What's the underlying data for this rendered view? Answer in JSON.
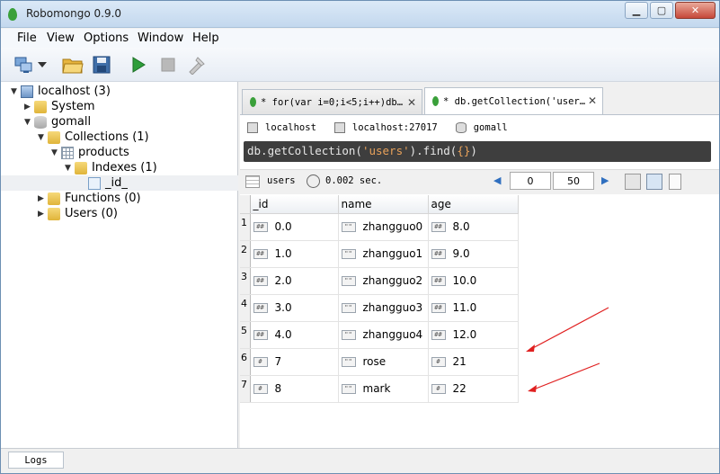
{
  "window": {
    "title": "Robomongo 0.9.0",
    "min_label": "▁",
    "max_label": "▢",
    "close_label": "✕"
  },
  "menu": [
    "File",
    "View",
    "Options",
    "Window",
    "Help"
  ],
  "toolbar": {
    "icons": [
      "connect-icon",
      "dropdown-icon",
      "open-icon",
      "save-icon",
      "run-icon",
      "stop-icon",
      "tools-icon"
    ]
  },
  "tree": {
    "server": "localhost (3)",
    "system": "System",
    "db": "gomall",
    "collections": "Collections (1)",
    "collection": "products",
    "indexes": "Indexes (1)",
    "index": "_id_",
    "functions": "Functions (0)",
    "users": "Users (0)"
  },
  "tabs": [
    {
      "label": "* for(var i=0;i<5;i++)db…",
      "close": "✕"
    },
    {
      "label": "* db.getCollection('user…",
      "close": "✕"
    }
  ],
  "breadcrumb": {
    "server": "localhost",
    "host": "localhost:27017",
    "db": "gomall"
  },
  "query": {
    "prefix": "db.getCollection(",
    "arg": "'users'",
    "suffix": ").find(",
    "braces": "{}",
    "close": ")"
  },
  "results_bar": {
    "collection": "users",
    "time": "0.002 sec.",
    "skip": "0",
    "limit": "50",
    "prev": "◀",
    "next": "▶"
  },
  "grid": {
    "columns": [
      "_id",
      "name",
      "age"
    ],
    "rows": [
      {
        "n": "1",
        "id": "0.0",
        "name": "zhangguo0",
        "age": "8.0",
        "id_type": "##",
        "name_type": "\"\"",
        "age_type": "##"
      },
      {
        "n": "2",
        "id": "1.0",
        "name": "zhangguo1",
        "age": "9.0",
        "id_type": "##",
        "name_type": "\"\"",
        "age_type": "##"
      },
      {
        "n": "3",
        "id": "2.0",
        "name": "zhangguo2",
        "age": "10.0",
        "id_type": "##",
        "name_type": "\"\"",
        "age_type": "##"
      },
      {
        "n": "4",
        "id": "3.0",
        "name": "zhangguo3",
        "age": "11.0",
        "id_type": "##",
        "name_type": "\"\"",
        "age_type": "##"
      },
      {
        "n": "5",
        "id": "4.0",
        "name": "zhangguo4",
        "age": "12.0",
        "id_type": "##",
        "name_type": "\"\"",
        "age_type": "##"
      },
      {
        "n": "6",
        "id": "7",
        "name": "rose",
        "age": "21",
        "id_type": "#",
        "name_type": "\"\"",
        "age_type": "#"
      },
      {
        "n": "7",
        "id": "8",
        "name": "mark",
        "age": "22",
        "id_type": "#",
        "name_type": "\"\"",
        "age_type": "#"
      }
    ]
  },
  "status": {
    "logs": "Logs"
  },
  "colors": {
    "query_bg": "#3e3e3e",
    "query_string": "#e8a15a",
    "annotation_arrow": "#e02020"
  }
}
